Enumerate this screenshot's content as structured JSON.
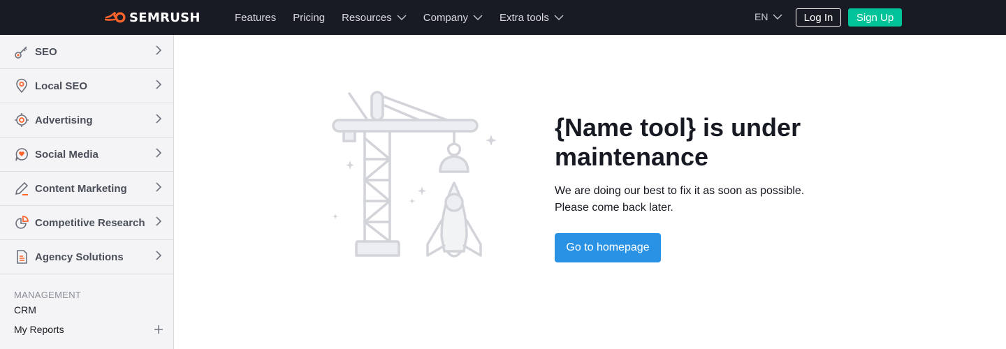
{
  "header": {
    "logo_text": "SEMRUSH",
    "nav": [
      {
        "label": "Features",
        "has_dropdown": false
      },
      {
        "label": "Pricing",
        "has_dropdown": false
      },
      {
        "label": "Resources",
        "has_dropdown": true
      },
      {
        "label": "Company",
        "has_dropdown": true
      },
      {
        "label": "Extra tools",
        "has_dropdown": true
      }
    ],
    "language": "EN",
    "login_label": "Log In",
    "signup_label": "Sign Up"
  },
  "sidebar": {
    "items": [
      {
        "label": "SEO",
        "icon": "seo-key-icon"
      },
      {
        "label": "Local SEO",
        "icon": "location-pin-icon"
      },
      {
        "label": "Advertising",
        "icon": "target-icon"
      },
      {
        "label": "Social Media",
        "icon": "chat-bubble-icon"
      },
      {
        "label": "Content Marketing",
        "icon": "pencil-icon"
      },
      {
        "label": "Competitive Research",
        "icon": "pie-chart-icon"
      },
      {
        "label": "Agency Solutions",
        "icon": "document-icon"
      }
    ],
    "section_label": "MANAGEMENT",
    "links": [
      {
        "label": "CRM"
      },
      {
        "label": "My Reports"
      }
    ]
  },
  "main": {
    "headline": "{Name tool} is under maintenance",
    "line1": "We are doing our best to fix it as soon as possible.",
    "line2": "Please come back later.",
    "button_label": "Go to homepage"
  },
  "colors": {
    "topbar": "#181b24",
    "brand_orange": "#ff642d",
    "signup_green": "#00c39a",
    "primary_blue": "#2a92e4"
  }
}
